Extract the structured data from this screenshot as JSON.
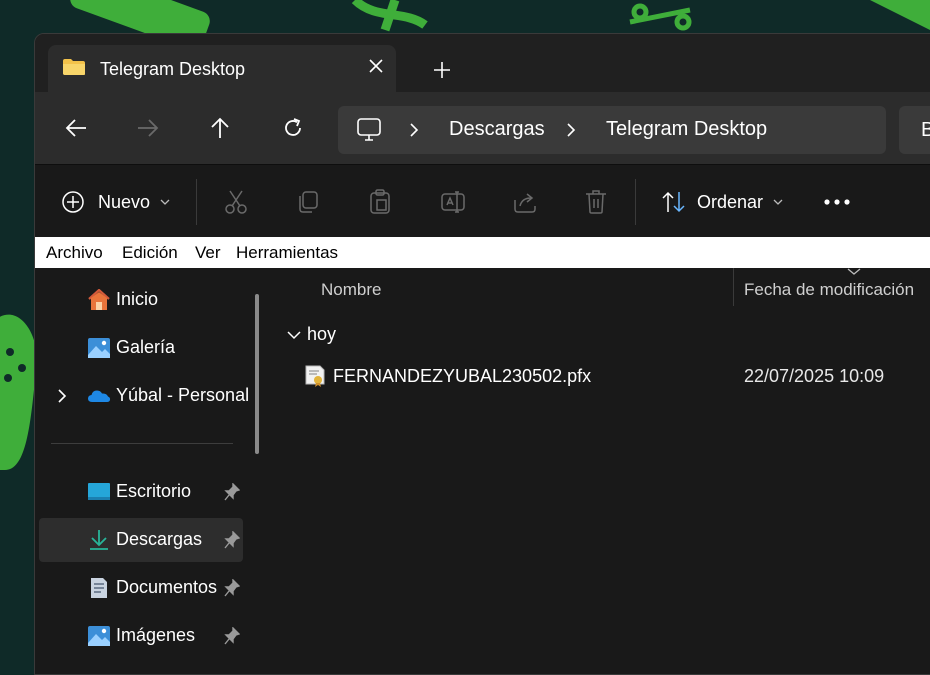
{
  "tab": {
    "title": "Telegram Desktop"
  },
  "address": {
    "crumbs": [
      "Descargas",
      "Telegram Desktop"
    ]
  },
  "search": {
    "partial": "B"
  },
  "toolbar": {
    "new_label": "Nuevo",
    "sort_label": "Ordenar"
  },
  "menu": [
    "Archivo",
    "Edición",
    "Ver",
    "Herramientas"
  ],
  "sidebar": {
    "items": [
      {
        "label": "Inicio",
        "icon": "home-icon"
      },
      {
        "label": "Galería",
        "icon": "gallery-icon"
      },
      {
        "label": "Yúbal - Personal",
        "icon": "onedrive-icon"
      },
      {
        "label": "Escritorio",
        "icon": "desktop-icon"
      },
      {
        "label": "Descargas",
        "icon": "download-icon"
      },
      {
        "label": "Documentos",
        "icon": "documents-icon"
      },
      {
        "label": "Imágenes",
        "icon": "pictures-icon"
      }
    ]
  },
  "columns": {
    "name": "Nombre",
    "modified": "Fecha de modificación"
  },
  "group": {
    "label": "hoy"
  },
  "files": [
    {
      "name": "FERNANDEZYUBAL230502.pfx",
      "modified": "22/07/2025 10:09"
    }
  ],
  "colors": {
    "window": "#191919",
    "titlebar": "#202020",
    "accent_green": "#4cc94c"
  }
}
